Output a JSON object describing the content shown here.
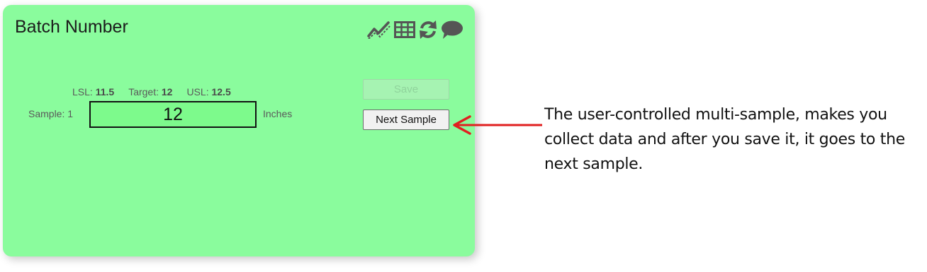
{
  "card": {
    "title": "Batch Number",
    "toolbar": [
      {
        "icon": "trend-chart-icon"
      },
      {
        "icon": "table-icon"
      },
      {
        "icon": "refresh-icon"
      },
      {
        "icon": "comment-icon"
      }
    ]
  },
  "limits": {
    "lsl_label": "LSL:",
    "lsl_value": "11.5",
    "target_label": "Target:",
    "target_value": "12",
    "usl_label": "USL:",
    "usl_value": "12.5"
  },
  "sample": {
    "label": "Sample: 1",
    "value": "12",
    "unit": "Inches"
  },
  "buttons": {
    "save_label": "Save",
    "next_label": "Next Sample"
  },
  "annotation": {
    "text": "The user-controlled multi-sample, makes you collect data and after you save it, it goes to the next sample."
  },
  "colors": {
    "card_bg": "#8afc9d",
    "input_bg": "#7dfa8c",
    "arrow": "#e02020",
    "icon": "#555555"
  }
}
